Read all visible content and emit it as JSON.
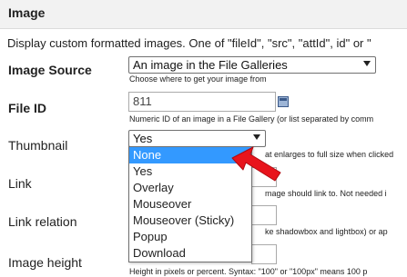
{
  "header": {
    "title": "Image"
  },
  "description": "Display custom formatted images. One of \"fileId\", \"src\", \"attId\", id\" or \"",
  "fields": {
    "image_source": {
      "label": "Image Source",
      "value": "An image in the File Galleries",
      "hint": "Choose where to get your image from"
    },
    "file_id": {
      "label": "File ID",
      "value": "811",
      "hint": "Numeric ID of an image in a File Gallery (or list separated by comm"
    },
    "thumbnail": {
      "label": "Thumbnail",
      "value": "Yes",
      "hint_partial": "at enlarges to full size when clicked",
      "options": [
        "None",
        "Yes",
        "Overlay",
        "Mouseover",
        "Mouseover (Sticky)",
        "Popup",
        "Download"
      ],
      "highlighted": "None"
    },
    "link": {
      "label": "Link",
      "hint_partial": "mage should link to. Not needed i"
    },
    "link_relation": {
      "label": "Link relation",
      "hint_partial": "ke shadowbox and lightbox) or ap"
    },
    "image_height": {
      "label": "Image height",
      "hint": "Height in pixels or percent. Syntax: \"100\" or \"100px\" means 100 p"
    }
  },
  "icons": {
    "image_picker": "image-picker-icon",
    "pointer_arrow": "red-arrow-icon",
    "dropdown_arrow": "chevron-down-icon"
  },
  "colors": {
    "highlight": "#3399ff",
    "arrow": "#e8141c",
    "header_bg": "#f2f2f2"
  }
}
